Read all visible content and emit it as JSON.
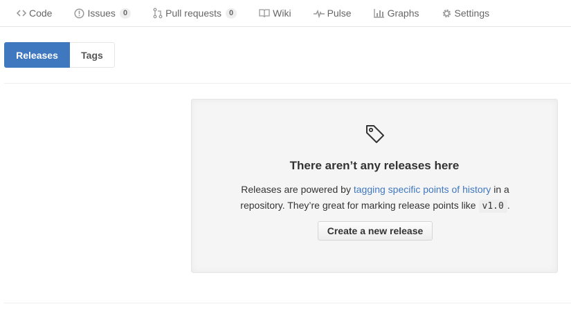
{
  "repo_nav": {
    "items": [
      {
        "label": "Code",
        "icon": "code-icon"
      },
      {
        "label": "Issues",
        "icon": "issue-opened-icon",
        "count": "0"
      },
      {
        "label": "Pull requests",
        "icon": "git-pull-request-icon",
        "count": "0"
      },
      {
        "label": "Wiki",
        "icon": "book-icon"
      },
      {
        "label": "Pulse",
        "icon": "pulse-icon"
      },
      {
        "label": "Graphs",
        "icon": "graph-icon"
      },
      {
        "label": "Settings",
        "icon": "gear-icon"
      }
    ]
  },
  "subnav": {
    "releases_label": "Releases",
    "tags_label": "Tags",
    "selected": "Releases"
  },
  "blankslate": {
    "icon": "tag-icon",
    "heading": "There aren’t any releases here",
    "text_before_link": "Releases are powered by ",
    "link_text": "tagging specific points of history",
    "text_after_link": " in a repository. They’re great for marking release points like ",
    "code_example": "v1.0",
    "text_end": ".",
    "button_label": "Create a new release"
  },
  "colors": {
    "accent": "#4078c0",
    "panel_background": "#f5f5f5",
    "border": "#e5e5e5"
  }
}
